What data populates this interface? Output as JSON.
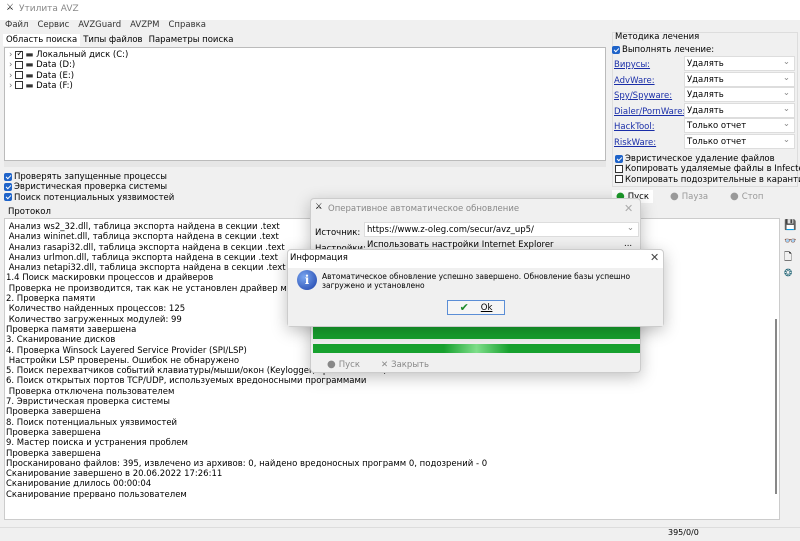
{
  "window": {
    "title": "Утилита AVZ"
  },
  "menu": [
    "Файл",
    "Сервис",
    "AVZGuard",
    "AVZPM",
    "Справка"
  ],
  "tabs": [
    "Область поиска",
    "Типы файлов",
    "Параметры поиска"
  ],
  "tree": [
    {
      "label": "Локальный диск (C:)",
      "checked": true
    },
    {
      "label": "Data (D:)",
      "checked": false
    },
    {
      "label": "Data (E:)",
      "checked": false
    },
    {
      "label": "Data (F:)",
      "checked": false
    }
  ],
  "options": [
    "Проверять запущенные процессы",
    "Эвристическая проверка системы",
    "Поиск потенциальных уязвимостей"
  ],
  "treatment": {
    "title": "Методика лечения",
    "enable": "Выполнять лечение:",
    "rows": [
      {
        "label": "Вирусы:",
        "value": "Удалять"
      },
      {
        "label": "AdvWare:",
        "value": "Удалять"
      },
      {
        "label": "Spy/Spyware:",
        "value": "Удалять"
      },
      {
        "label": "Dialer/PornWare:",
        "value": "Удалять"
      },
      {
        "label": "HackTool:",
        "value": "Только отчет"
      },
      {
        "label": "RiskWare:",
        "value": "Только отчет"
      }
    ],
    "checks": [
      {
        "label": "Эвристическое удаление файлов",
        "checked": true
      },
      {
        "label": "Копировать удаляемые файлы в  Infected",
        "checked": false
      },
      {
        "label": "Копировать подозрительные в  карантин",
        "checked": false
      }
    ],
    "buttons": {
      "start": "Пуск",
      "pause": "Пауза",
      "stop": "Стоп"
    }
  },
  "protocol": {
    "title": "Протокол",
    "lines": [
      " Анализ ws2_32.dll, таблица экспорта найдена в секции .text",
      " Анализ wininet.dll, таблица экспорта найдена в секции .text",
      " Анализ rasapi32.dll, таблица экспорта найдена в секции .text",
      " Анализ urlmon.dll, таблица экспорта найдена в секции .text",
      " Анализ netapi32.dll, таблица экспорта найдена в секции .text",
      "1.4 Поиск маскировки процессов и драйверов",
      " Проверка не производится, так как не установлен драйвер мониторинга AVZPM",
      "2. Проверка памяти",
      " Количество найденных процессов: 125",
      " Количество загруженных модулей: 99",
      "Проверка памяти завершена",
      "3. Сканирование дисков",
      "4. Проверка Winsock Layered Service Provider (SPI/LSP)",
      " Настройки LSP проверены. Ошибок не обнаружено",
      "5. Поиск перехватчиков событий клавиатуры/мыши/окон (Keylogger, троянские DLL)",
      "6. Поиск открытых портов TCP/UDP, используемых вредоносными программами",
      " Проверка отключена пользователем",
      "7. Эвристическая проверка системы",
      "Проверка завершена",
      "8. Поиск потенциальных уязвимостей",
      "Проверка завершена",
      "9. Мастер поиска и устранения проблем",
      "Проверка завершена",
      "Просканировано файлов: 395, извлечено из архивов: 0, найдено вредоносных программ 0, подозрений - 0",
      "Сканирование завершено в 20.06.2022 17:26:11",
      "Сканирование длилось 00:00:04",
      "Сканирование прервано пользователем"
    ]
  },
  "status": {
    "counts": "395/0/0"
  },
  "update_dialog": {
    "title": "Оперативное автоматическое обновление",
    "source_label": "Источник:",
    "source_value": "https://www.z-oleg.com/secur/avz_up5/",
    "settings_label": "Настройки:",
    "settings_value": "Использовать настройки Internet Explorer",
    "more": "...",
    "start": "Пуск",
    "close": "Закрыть",
    "progress": [
      1.0,
      1.0
    ]
  },
  "info_dialog": {
    "title": "Информация",
    "message": "Автоматическое обновление успешно завершено. Обновление базы успешно загружено и установлено",
    "ok": "Ok"
  }
}
